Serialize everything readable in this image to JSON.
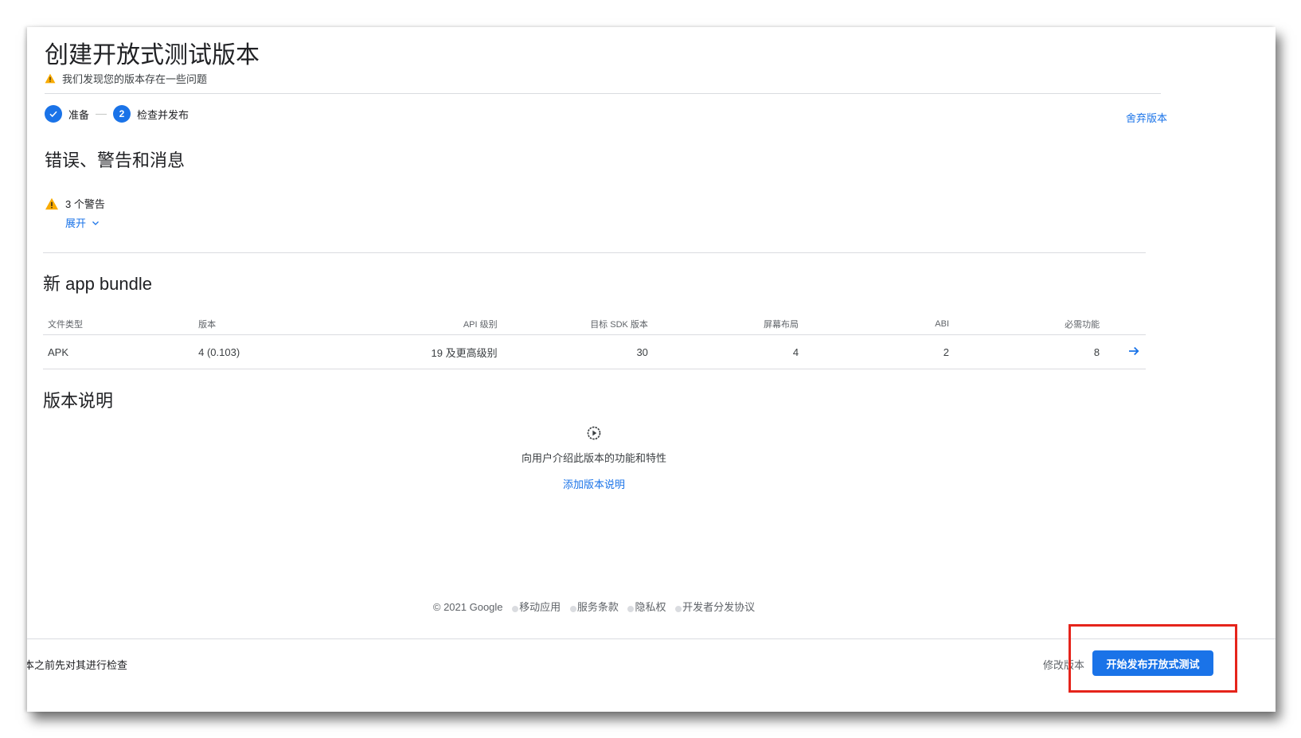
{
  "page": {
    "title": "创建开放式测试版本",
    "warning_text": "我们发现您的版本存在一些问题"
  },
  "stepper": {
    "steps": [
      {
        "label": "准备",
        "state": "done"
      },
      {
        "label": "检查并发布",
        "state": "current",
        "number": "2"
      }
    ],
    "discard_link": "舍弃版本"
  },
  "messages": {
    "title": "错误、警告和消息",
    "warnings_count": "3 个警告",
    "expand_label": "展开"
  },
  "bundle": {
    "title": "新 app bundle",
    "columns": [
      "文件类型",
      "版本",
      "API 级别",
      "目标 SDK 版本",
      "屏幕布局",
      "ABI",
      "必需功能"
    ],
    "rows": [
      {
        "file_type": "APK",
        "version": "4 (0.103)",
        "api_level": "19 及更高级别",
        "target_sdk": "30",
        "screen_layouts": "4",
        "abi": "2",
        "required_features": "8"
      }
    ]
  },
  "release_notes": {
    "title": "版本说明",
    "empty_text": "向用户介绍此版本的功能和特性",
    "add_link": "添加版本说明"
  },
  "footer": {
    "copyright": "© 2021 Google",
    "links": [
      "移动应用",
      "服务条款",
      "隐私权",
      "开发者分发协议"
    ]
  },
  "bottom_bar": {
    "text": "本之前先对其进行检查",
    "edit_button": "修改版本",
    "primary_button": "开始发布开放式测试"
  },
  "colors": {
    "accent": "#1a73e8",
    "warning": "#f9ab00",
    "highlight": "#e5241b"
  }
}
